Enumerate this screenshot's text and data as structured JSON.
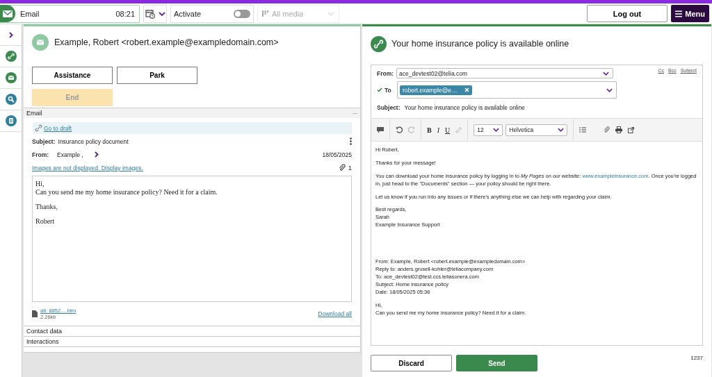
{
  "top_bar": {
    "channel": {
      "label": "Email",
      "time": "08:21"
    },
    "activate": {
      "label": "Activate",
      "on": false
    },
    "media_filter": {
      "placeholder": "All media",
      "disabled": true
    },
    "logout": "Log out",
    "menu": "Menu"
  },
  "sidebar": {
    "items": [
      {
        "kind": "expand"
      },
      {
        "kind": "link"
      },
      {
        "kind": "email"
      },
      {
        "kind": "search"
      },
      {
        "kind": "notes"
      }
    ]
  },
  "left": {
    "contact": "Example, Robert <robert.example@exampledomain.com>",
    "actions": [
      "Assistance",
      "Park"
    ],
    "end": {
      "label": "End",
      "disabled": true
    },
    "email_section": {
      "title": "Email",
      "expanded": true,
      "draft_link": "Go to draft",
      "subject_label": "Subject:",
      "subject": "Insurance policy document",
      "from_label": "From:",
      "from": "Example ,",
      "date": "18/05/2025",
      "images_notice": "Images are not displayed. Display images.",
      "attachment_count": "1",
      "body": [
        [
          "Hi,",
          "Can you send me my home insurance policy? Need it for a claim."
        ],
        [
          "Thanks,"
        ],
        [
          "Robert"
        ]
      ],
      "attachment": {
        "name": "att_8852….htm",
        "size": "2.26kb"
      },
      "download_all": "Download all"
    },
    "collapsed_sections": [
      {
        "title": "Contact data"
      },
      {
        "title": "Interactions"
      }
    ]
  },
  "right": {
    "title": "Your home insurance policy is available online",
    "from_label": "From:",
    "from": "ace_devtest02@telia.com",
    "to_label": "To",
    "to_valid": true,
    "recipient": "robert.example@e…",
    "field_links": [
      "Cc",
      "Bcc",
      "Subject"
    ],
    "subject_label": "Subject:",
    "subject": "Your home insurance policy is available online",
    "toolbar": {
      "format_buttons": [
        "B",
        "I",
        "U"
      ],
      "font_size": "12",
      "font": "Helvetica"
    },
    "paragraphs": [
      {
        "text": "Hi Robert,"
      },
      {
        "text": "Thanks for your message!"
      },
      {
        "text": "You can download your home insurance policy by logging in to *My Pages* on our website: ",
        "link": "www.exampleinsurance.com",
        "after": ". Once you're logged in, just head to the \"Documents\" section — your policy should be right there."
      },
      {
        "text": "Let us know if you run into any issues or if there's anything else we can help with regarding your claim."
      },
      {
        "lines": [
          "Best regards,",
          "Sarah",
          "Example Insurance Support"
        ]
      }
    ],
    "quoted": [
      [
        "From: Example, Robert <robert.example@exampledomain.com>",
        "Reply to: anders.grusell-kohler@teliacompany.com",
        "To: ace_devtest02@test.ccs.teliasonera.com",
        "Subject: Home insurance policy",
        "Date: 18/05/2025 05:36"
      ],
      [
        "Hi,",
        "Can you send me my home insurance policy? Need it for a claim."
      ]
    ],
    "discard": "Discard",
    "send": "Send",
    "char_count": "1237"
  }
}
